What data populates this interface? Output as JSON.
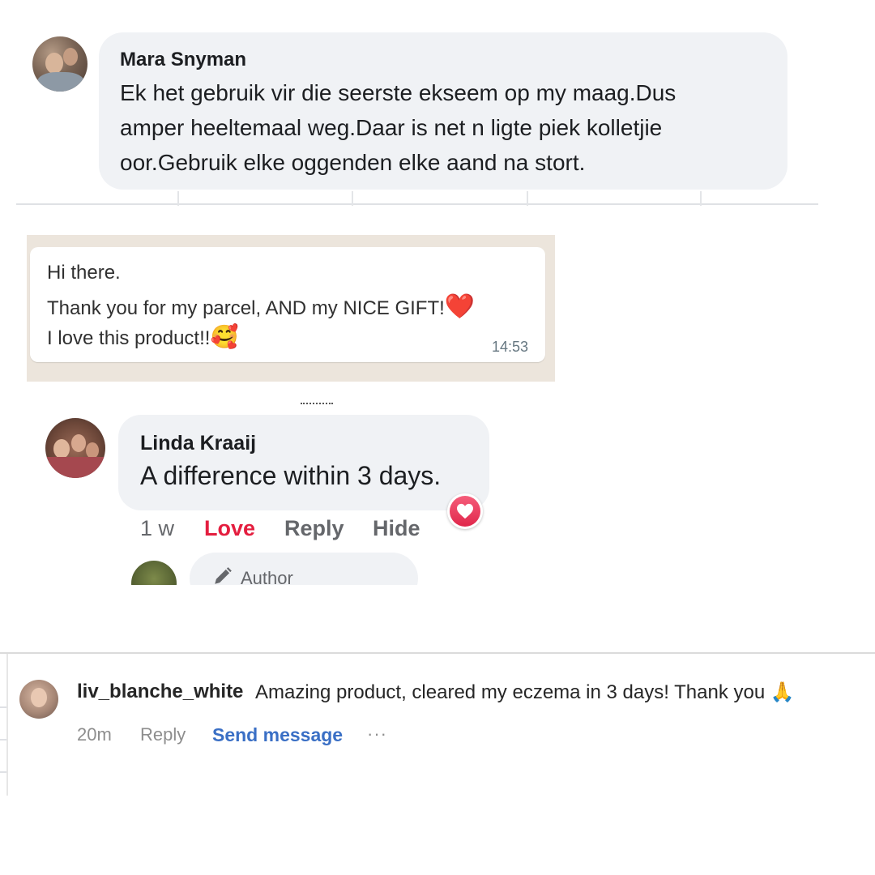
{
  "comment_1": {
    "author": "Mara Snyman",
    "text_lines": [
      "Ek het gebruik vir die seerste ekseem op my maag.Dus",
      "amper heeltemaal weg.Daar is net n ligte piek kolletjie",
      "oor.Gebruik elke oggenden elke aand na stort."
    ]
  },
  "whatsapp_message": {
    "lines": [
      "Hi there.",
      "Thank you for my parcel, AND my NICE GIFT!",
      "I love this product!!"
    ],
    "emoji_1": "❤️",
    "emoji_2": "🥰",
    "time": "14:53"
  },
  "comment_2": {
    "author": "Linda Kraaij",
    "text": "A difference within 3 days.",
    "time": "1 w",
    "actions": {
      "love": "Love",
      "reply": "Reply",
      "hide": "Hide"
    },
    "reaction_icon": "heart-icon",
    "reply_box_label": "Author"
  },
  "comment_3": {
    "username": "liv_blanche_white",
    "text": "Amazing product, cleared my eczema in 3 days! Thank you",
    "emoji": "🙏",
    "time": "20m",
    "reply_label": "Reply",
    "send_label": "Send message",
    "more_label": "···"
  },
  "colors": {
    "bubble_bg": "#f0f2f5",
    "love_red": "#e41e3f",
    "link_blue": "#3a6fc5",
    "whatsapp_bg": "#ece5dc"
  }
}
